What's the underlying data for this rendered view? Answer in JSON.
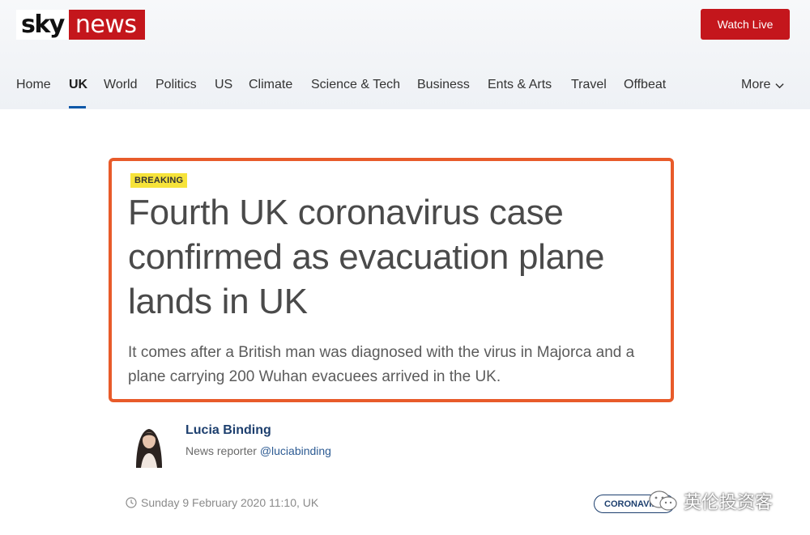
{
  "brand": {
    "sky": "sky",
    "news": "news",
    "red": "#c4161c"
  },
  "header": {
    "watch_live": "Watch Live"
  },
  "nav": {
    "items": [
      "Home",
      "UK",
      "World",
      "Politics",
      "US",
      "Climate",
      "Science & Tech",
      "Business",
      "Ents & Arts",
      "Travel",
      "Offbeat"
    ],
    "active": "UK",
    "more": "More"
  },
  "article": {
    "badge": "BREAKING",
    "title": "Fourth UK coronavirus case confirmed as evacuation plane lands in UK",
    "summary": "It comes after a British man was diagnosed with the virus in Majorca and a plane carrying 200 Wuhan evacuees arrived in the UK.",
    "author_name": "Lucia Binding",
    "author_role": "News reporter",
    "author_handle": "@luciabinding",
    "date": "Sunday 9 February 2020 11:10, UK",
    "tag": "CORONAVIRU"
  },
  "watermark": {
    "text": "英伦投资客"
  },
  "highlight_color": "#e85b2a"
}
